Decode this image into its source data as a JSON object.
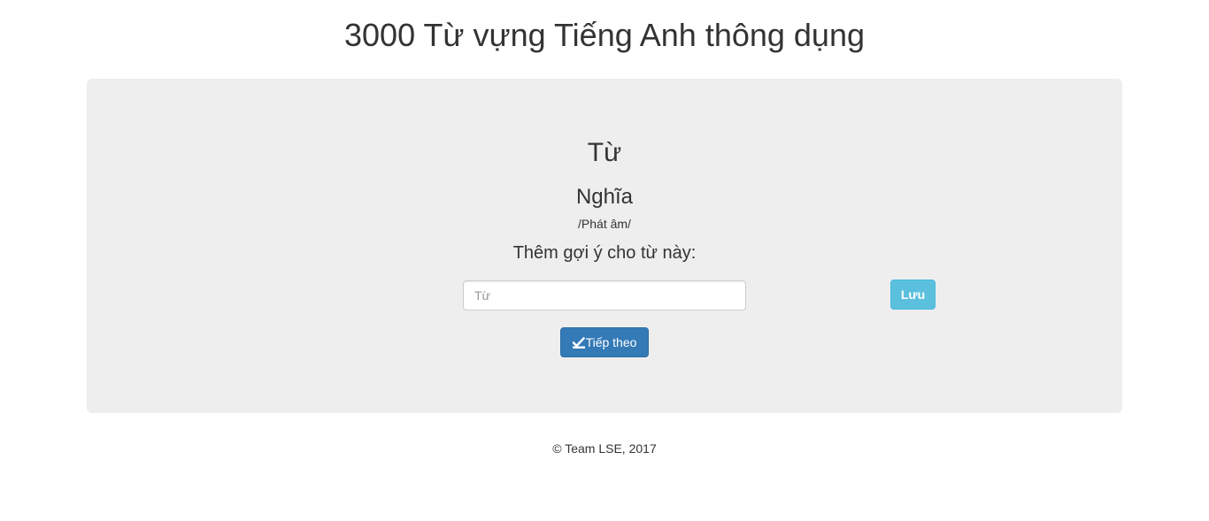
{
  "header": {
    "title": "3000 Từ vựng Tiếng Anh thông dụng"
  },
  "card": {
    "word": "Từ",
    "meaning": "Nghĩa",
    "pronunciation": "/Phát âm/",
    "hint_label": "Thêm gợi ý cho từ này:",
    "hint_input": {
      "value": "",
      "placeholder": "Từ"
    },
    "save_label": "Lưu",
    "next_label": "Tiếp theo",
    "next_icon": "check-edit-icon"
  },
  "footer": {
    "text": "© Team LSE, 2017"
  },
  "colors": {
    "save_button": "#5bc0de",
    "next_button": "#337ab7",
    "panel_background": "#eeeeee"
  }
}
